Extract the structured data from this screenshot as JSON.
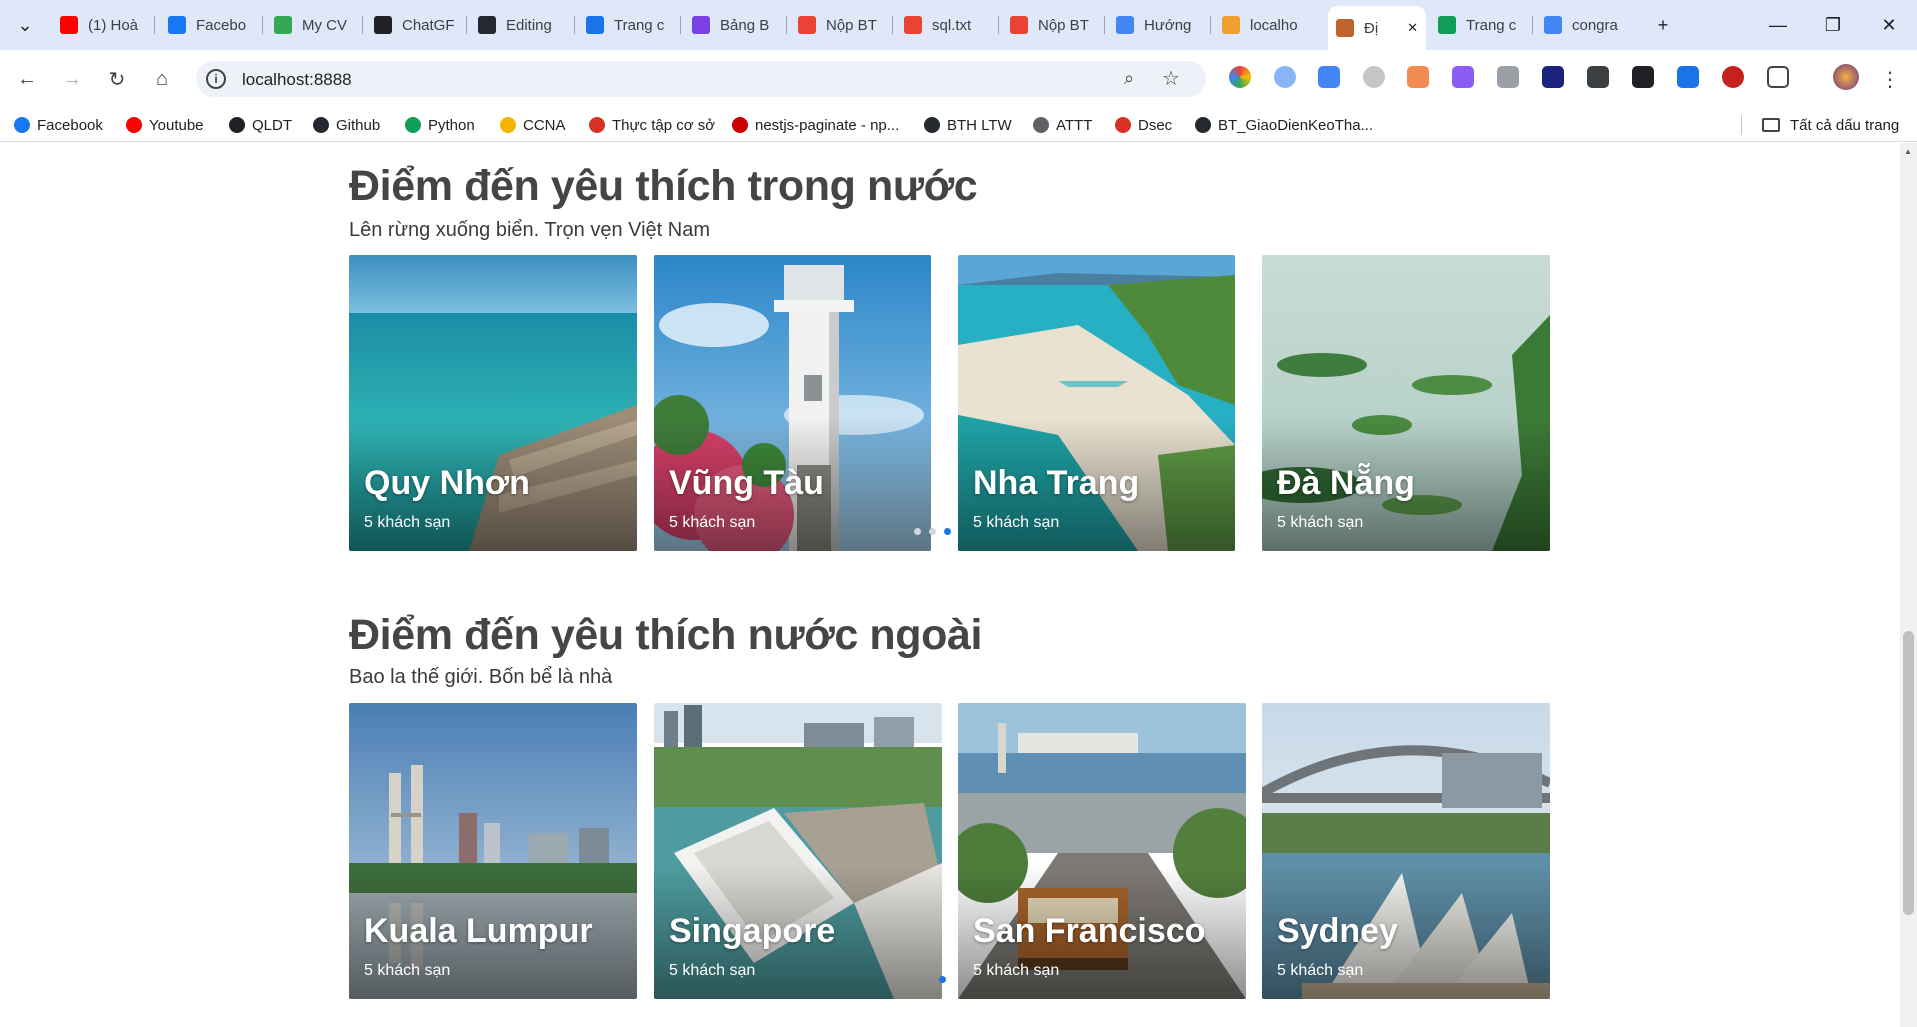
{
  "tabs": [
    {
      "label": "(1) Hoà",
      "icon": "youtube-icon",
      "color": "#ff0000"
    },
    {
      "label": "Facebo",
      "icon": "facebook-icon",
      "color": "#1877f2"
    },
    {
      "label": "My CV",
      "icon": "cv-icon",
      "color": "#34a853"
    },
    {
      "label": "ChatGF",
      "icon": "chatgpt-icon",
      "color": "#202124"
    },
    {
      "label": "Editing",
      "icon": "github-icon",
      "color": "#24292f"
    },
    {
      "label": "Trang c",
      "icon": "site-icon",
      "color": "#1a73e8"
    },
    {
      "label": "Bảng B",
      "icon": "board-icon",
      "color": "#7b3fe4"
    },
    {
      "label": "Nộp BT",
      "icon": "gmail-icon",
      "color": "#ea4335"
    },
    {
      "label": "sql.txt",
      "icon": "gmail-icon",
      "color": "#ea4335"
    },
    {
      "label": "Nộp BT",
      "icon": "gmail-icon",
      "color": "#ea4335"
    },
    {
      "label": "Hướng",
      "icon": "docs-icon",
      "color": "#4285f4"
    },
    {
      "label": "localho",
      "icon": "phpmyadmin-icon",
      "color": "#f0a030"
    },
    {
      "label": "Đị",
      "icon": "travel-icon",
      "color": "#c0622b",
      "active": true
    },
    {
      "label": "Trang c",
      "icon": "drive-icon",
      "color": "#0f9d58"
    },
    {
      "label": "congra",
      "icon": "google-icon",
      "color": "#4285f4"
    }
  ],
  "address_bar": {
    "url": "localhost:8888"
  },
  "bookmarks": [
    {
      "label": "Facebook",
      "icon": "facebook-icon",
      "color": "#1877f2"
    },
    {
      "label": "Youtube",
      "icon": "youtube-icon",
      "color": "#ff0000"
    },
    {
      "label": "QLDT",
      "icon": "angular-icon",
      "color": "#202124"
    },
    {
      "label": "Github",
      "icon": "github-icon",
      "color": "#24292f"
    },
    {
      "label": "Python",
      "icon": "drive-icon",
      "color": "#0f9d58"
    },
    {
      "label": "CCNA",
      "icon": "drive-icon",
      "color": "#f4b400"
    },
    {
      "label": "Thực tập cơ sở",
      "icon": "link-icon",
      "color": "#d93025"
    },
    {
      "label": "nestjs-paginate - np...",
      "icon": "npm-icon",
      "color": "#cb0000"
    },
    {
      "label": "BTH LTW",
      "icon": "github-icon",
      "color": "#24292f"
    },
    {
      "label": "ATTT",
      "icon": "globe-icon",
      "color": "#5f6368"
    },
    {
      "label": "Dsec",
      "icon": "link-icon",
      "color": "#d93025"
    },
    {
      "label": "BT_GiaoDienKeoTha...",
      "icon": "github-icon",
      "color": "#24292f"
    }
  ],
  "all_bookmarks_label": "Tất cả dấu trang",
  "sections": [
    {
      "title": "Điểm đến yêu thích trong nước",
      "subtitle": "Lên rừng xuống biển. Trọn vẹn Việt Nam",
      "cards": [
        {
          "name": "Quy Nhơn",
          "count": "5 khách sạn"
        },
        {
          "name": "Vũng Tàu",
          "count": "5 khách sạn"
        },
        {
          "name": "Nha Trang",
          "count": "5 khách sạn"
        },
        {
          "name": "Đà Nẵng",
          "count": "5 khách sạn"
        }
      ]
    },
    {
      "title": "Điểm đến yêu thích nước ngoài",
      "subtitle": "Bao la thế giới. Bốn bể là nhà",
      "cards": [
        {
          "name": "Kuala Lumpur",
          "count": "5 khách sạn"
        },
        {
          "name": "Singapore",
          "count": "5 khách sạn"
        },
        {
          "name": "San Francisco",
          "count": "5 khách sạn"
        },
        {
          "name": "Sydney",
          "count": "5 khách sạn"
        }
      ]
    }
  ],
  "colors": {
    "accent": "#1a73e8",
    "heading": "#454545",
    "tabstrip": "#dee8f8"
  }
}
